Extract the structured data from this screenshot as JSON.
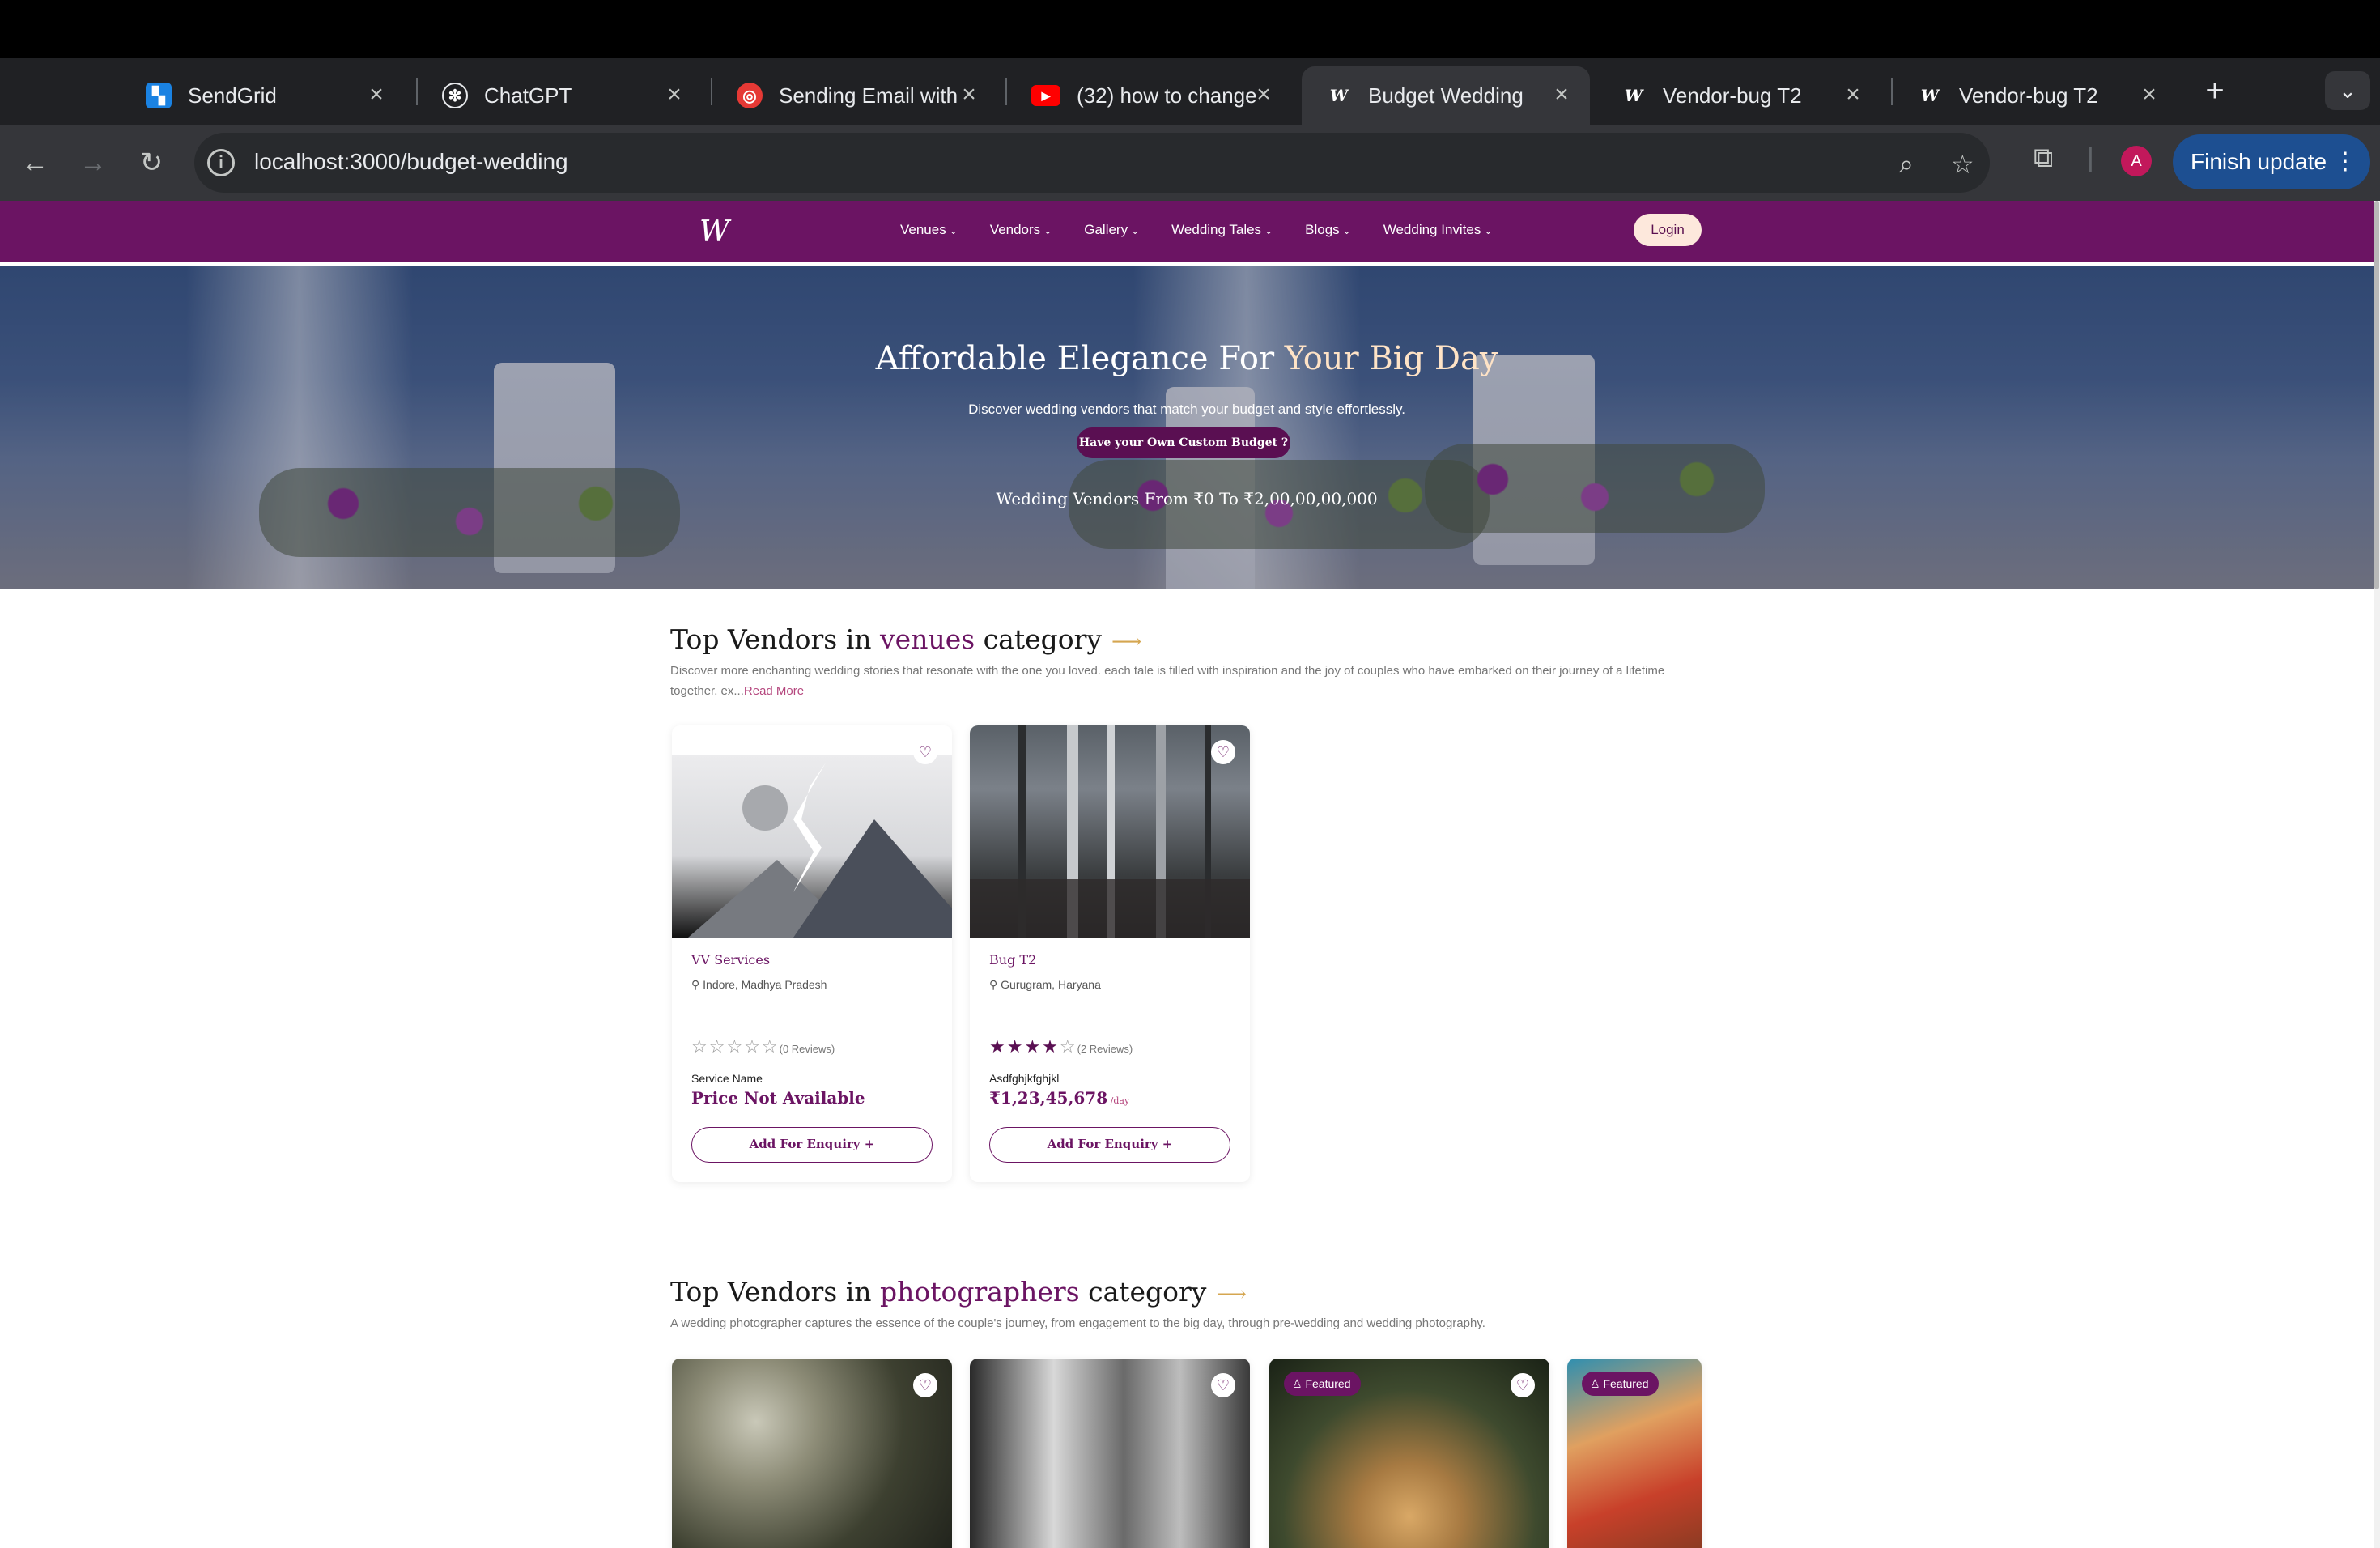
{
  "browser": {
    "tabs": [
      {
        "title": "SendGrid",
        "icon": "sendgrid-icon",
        "color": "#1a82e2"
      },
      {
        "title": "ChatGPT",
        "icon": "chatgpt-icon",
        "color": "#202124"
      },
      {
        "title": "Sending Email with",
        "icon": "sending-email-icon",
        "color": "#e53935"
      },
      {
        "title": "(32) how to change",
        "icon": "youtube-icon",
        "color": "#ff0000"
      },
      {
        "title": "Budget Wedding",
        "icon": "site-logo-icon",
        "color": "#35363a"
      },
      {
        "title": "Vendor-bug T2",
        "icon": "site-logo-icon",
        "color": "#202124"
      },
      {
        "title": "Vendor-bug T2",
        "icon": "site-logo-icon",
        "color": "#202124"
      }
    ],
    "url": "localhost:3000/budget-wedding",
    "avatar_letter": "A",
    "finish_update": "Finish update"
  },
  "site": {
    "logo": "W",
    "menu": [
      "Venues",
      "Vendors",
      "Gallery",
      "Wedding Tales",
      "Blogs",
      "Wedding Invites"
    ],
    "login": "Login"
  },
  "hero": {
    "title_main": "Affordable Elegance For ",
    "title_highlight": "Your Big Day",
    "subtitle": "Discover wedding vendors that match your budget and style effortlessly.",
    "custom_budget_button": "Have your Own Custom Budget ?",
    "range_text": "Wedding Vendors From ₹0 To ₹2,00,00,00,000"
  },
  "sections": [
    {
      "title_prefix": "Top Vendors in ",
      "category": "venues",
      "title_suffix": " category",
      "description": "Discover more enchanting wedding stories that resonate with the one you loved. each tale is filled with inspiration and the joy of couples who have embarked on their journey of a lifetime together. ex...",
      "read_more": "Read More",
      "cards": [
        {
          "name": "VV Services",
          "location": "Indore, Madhya Pradesh",
          "rating": 0,
          "stars": "☆☆☆☆☆",
          "reviews": "(0 Reviews)",
          "service": "Service Name",
          "price": "Price Not Available",
          "price_unit": "",
          "enquiry": "Add For Enquiry  +"
        },
        {
          "name": "Bug T2",
          "location": "Gurugram, Haryana",
          "rating": 4,
          "stars_filled": "★★★★",
          "stars_empty": "☆",
          "reviews": "(2 Reviews)",
          "service": "Asdfghjkfghjkl",
          "price": "₹1,23,45,678",
          "price_unit": " /day",
          "enquiry": "Add For Enquiry  +"
        }
      ]
    },
    {
      "title_prefix": "Top Vendors in ",
      "category": "photographers",
      "title_suffix": " category",
      "description": "A wedding photographer captures the essence of the couple's journey, from engagement to the big day, through pre-wedding and wedding photography.",
      "featured_label": "Featured"
    }
  ]
}
